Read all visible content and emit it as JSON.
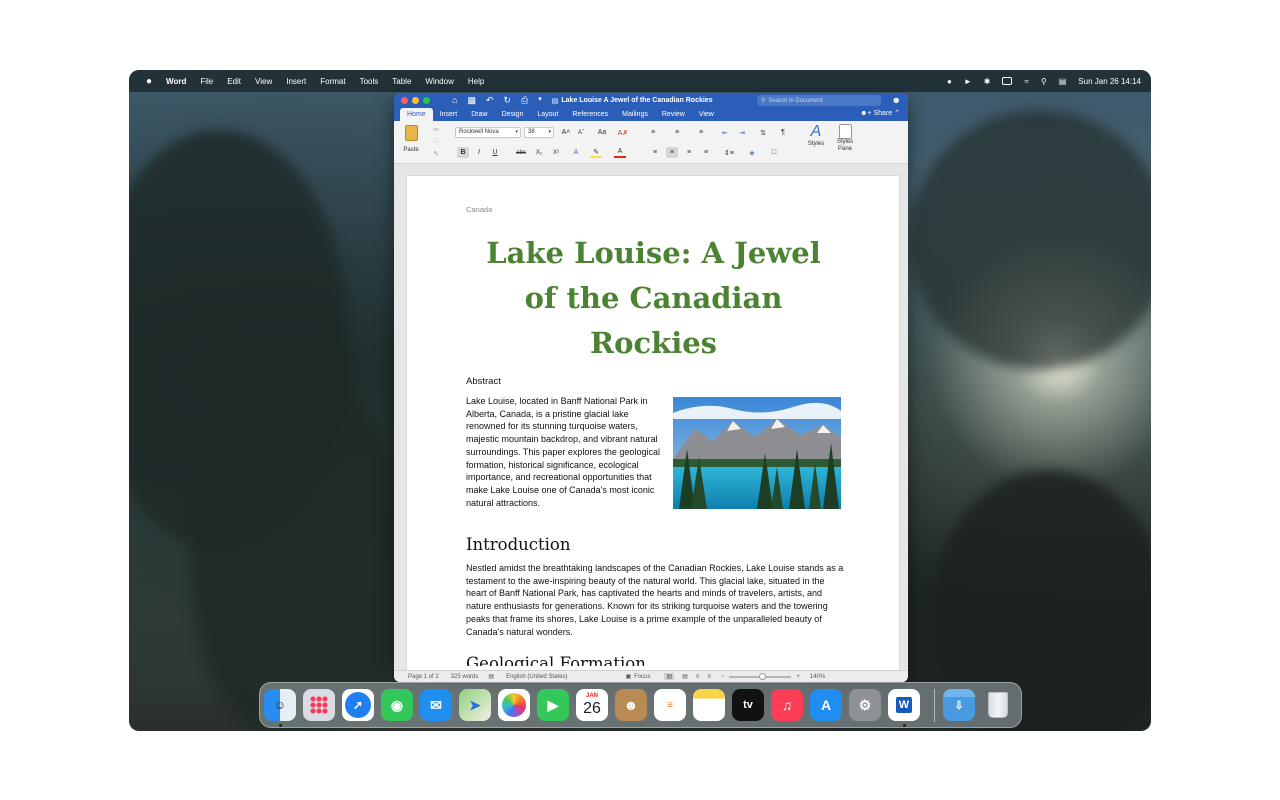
{
  "menubar": {
    "apple_icon": "apple-icon",
    "items": [
      "Word",
      "File",
      "Edit",
      "View",
      "Insert",
      "Format",
      "Tools",
      "Table",
      "Window",
      "Help"
    ],
    "status_icons": [
      "lightbulb-icon",
      "volume-icon",
      "bluetooth-icon",
      "battery-icon",
      "wifi-icon",
      "spotlight-icon",
      "control-center-icon"
    ],
    "clock": "Sun Jan 26  14:14"
  },
  "window": {
    "title": "Lake Louise A Jewel of the Canadian Rockies",
    "search_placeholder": "Search in Document",
    "tabs": [
      "Home",
      "Insert",
      "Draw",
      "Design",
      "Layout",
      "References",
      "Mailings",
      "Review",
      "View"
    ],
    "active_tab": "Home",
    "share_label": "Share",
    "ribbon": {
      "paste_label": "Paste",
      "font_name": "Rockwell Nova",
      "font_size": "38",
      "bold": "B",
      "italic": "I",
      "underline": "U",
      "strike": "abc",
      "subscript": "X₂",
      "superscript": "X²",
      "styles_label": "Styles",
      "styles_pane_label": "Styles Pane",
      "styles_pane_label_2": "Pane"
    }
  },
  "document": {
    "header": "Canada",
    "title": "Lake Louise: A Jewel of the Canadian Rockies",
    "abstract_heading": "Abstract",
    "abstract_text": "Lake Louise, located in Banff National Park in Alberta, Canada, is a pristine glacial lake renowned for its stunning turquoise waters, majestic mountain backdrop, and vibrant natural surroundings. This paper explores the geological formation, historical significance, ecological importance, and recreational opportunities that make Lake Louise one of Canada's most iconic natural attractions.",
    "intro_heading": "Introduction",
    "intro_text": "Nestled amidst the breathtaking landscapes of the Canadian Rockies, Lake Louise stands as a testament to the awe-inspiring beauty of the natural world. This glacial lake, situated in the heart of Banff National Park, has captivated the hearts and minds of travelers, artists, and nature enthusiasts for generations. Known for its striking turquoise waters and the towering peaks that frame its shores, Lake Louise is a prime example of the unparalleled beauty of Canada's natural wonders.",
    "next_heading": "Geological Formation"
  },
  "statusbar": {
    "page": "Page 1 of 2",
    "words": "325 words",
    "language": "English (United States)",
    "focus": "Focus",
    "zoom": "140%"
  },
  "dock": {
    "apps": [
      "finder",
      "launchpad",
      "safari",
      "messages",
      "mail",
      "maps",
      "photos",
      "facetime",
      "calendar",
      "contacts",
      "reminders",
      "notes",
      "apple-tv",
      "music",
      "app-store",
      "system-settings",
      "word",
      "downloads",
      "trash"
    ],
    "calendar_month": "JAN",
    "calendar_day": "26",
    "tv_label": "tv",
    "word_letter": "W"
  }
}
